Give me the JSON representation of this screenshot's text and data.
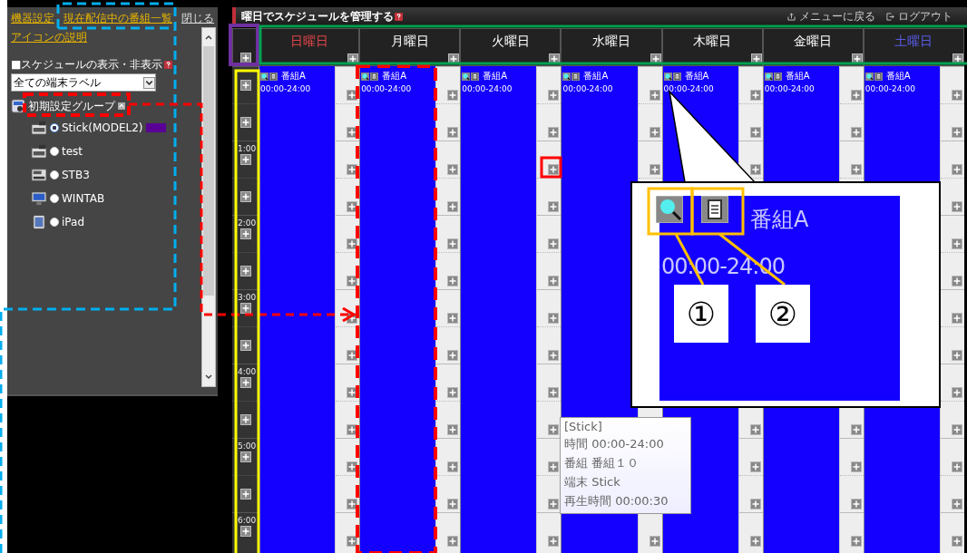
{
  "sidebar": {
    "links": [
      {
        "label": "機器設定"
      },
      {
        "label": "現在配信中の番組一覧"
      }
    ],
    "close": "閉じる",
    "icon_help_link": "アイコンの説明",
    "section_title": "■スケジュールの表示・非表示",
    "filter_select": {
      "value": "全ての端末ラベル"
    },
    "group": {
      "label": "初期設定グループ"
    },
    "devices": [
      {
        "label": "Stick(MODEL2)",
        "kind": "stick",
        "selected": true,
        "color": "#5a0096"
      },
      {
        "label": "test",
        "kind": "stick",
        "selected": false
      },
      {
        "label": "STB3",
        "kind": "stb",
        "selected": false
      },
      {
        "label": "WINTAB",
        "kind": "monitor",
        "selected": false
      },
      {
        "label": "iPad",
        "kind": "tablet",
        "selected": false
      }
    ]
  },
  "header": {
    "title": "曜日でスケジュールを管理する",
    "menu_link": "メニューに戻る",
    "logout": "ログアウト"
  },
  "days": [
    {
      "label": "日曜日",
      "kind": "sunday",
      "program": {
        "title": "番組A",
        "time": "00:00-24:00"
      }
    },
    {
      "label": "月曜日",
      "kind": "weekday",
      "program": {
        "title": "番組A",
        "time": "00:00-24:00"
      }
    },
    {
      "label": "火曜日",
      "kind": "weekday",
      "program": {
        "title": "番組A",
        "time": "00:00-24:00"
      }
    },
    {
      "label": "水曜日",
      "kind": "weekday",
      "program": {
        "title": "番組A",
        "time": "00:00-24:00"
      }
    },
    {
      "label": "木曜日",
      "kind": "weekday",
      "program": {
        "title": "番組A",
        "time": "00:00-24:00"
      }
    },
    {
      "label": "金曜日",
      "kind": "weekday",
      "program": {
        "title": "番組A",
        "time": "00:00-24:00"
      }
    },
    {
      "label": "土曜日",
      "kind": "saturday",
      "program": {
        "title": "番組A",
        "time": "00:00-24:00"
      }
    }
  ],
  "times": [
    "1:00",
    "2:00",
    "3:00",
    "4:00",
    "5:00",
    "6:00"
  ],
  "callout": {
    "title": "番組A",
    "time": "00:00-24:00",
    "markers": [
      "①",
      "②"
    ]
  },
  "tooltip": {
    "lines": [
      "[Stick]",
      "時間 00:00-24:00",
      "番組 番組１０",
      "端末 Stick",
      "再生時間 00:00:30"
    ]
  }
}
